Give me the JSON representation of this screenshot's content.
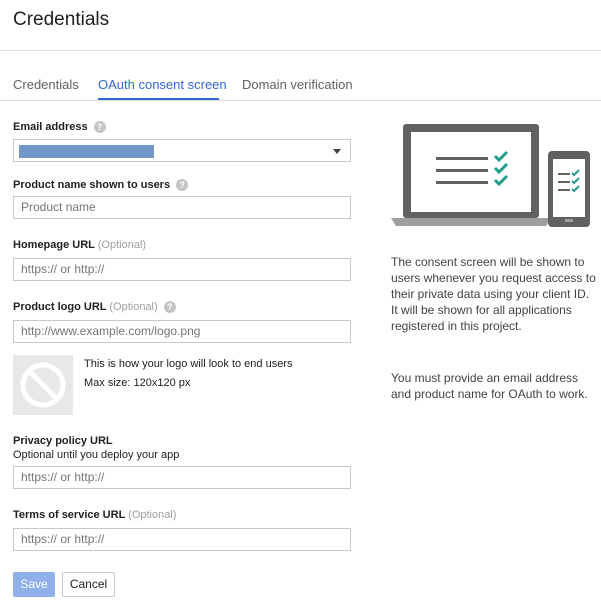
{
  "header": {
    "title": "Credentials"
  },
  "tabs": [
    {
      "label": "Credentials",
      "active": false
    },
    {
      "label": "OAuth consent screen",
      "active": true
    },
    {
      "label": "Domain verification",
      "active": false
    }
  ],
  "form": {
    "email": {
      "label": "Email address",
      "help_icon": "help-icon",
      "selected_value": ""
    },
    "product_name": {
      "label": "Product name shown to users",
      "placeholder": "Product name",
      "help_icon": "help-icon"
    },
    "homepage": {
      "label": "Homepage URL",
      "optional": "(Optional)",
      "placeholder": "https:// or http://"
    },
    "logo": {
      "label": "Product logo URL",
      "optional": "(Optional)",
      "placeholder": "http://www.example.com/logo.png",
      "help_icon": "help-icon",
      "hint_line1": "This is how your logo will look to end users",
      "hint_line2": "Max size: 120x120 px"
    },
    "privacy": {
      "label": "Privacy policy URL",
      "sublabel": "Optional until you deploy your app",
      "placeholder": "https:// or http://"
    },
    "terms": {
      "label": "Terms of service URL",
      "optional": "(Optional)",
      "placeholder": "https:// or http://"
    },
    "save_label": "Save",
    "cancel_label": "Cancel"
  },
  "info": {
    "paragraph1": "The consent screen will be shown to users whenever you request access to their private data using your client ID. It will be shown for all applications registered in this project.",
    "paragraph2": "You must provide an email address and product name for OAuth to work."
  },
  "colors": {
    "accent": "#3367d6",
    "check": "#1e9e8b",
    "save_button": "#8fb0e9"
  }
}
